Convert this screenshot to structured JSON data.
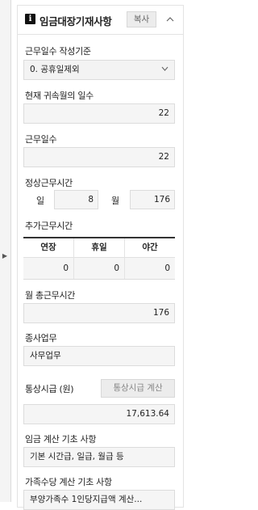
{
  "panel": {
    "title": "임금대장기재사항",
    "copy_label": "복사",
    "collapse_glyph": "^"
  },
  "rail": {
    "arrow_glyph": "▶"
  },
  "work_days_basis": {
    "label": "근무일수 작성기준",
    "value": "0. 공휴일제외"
  },
  "days_in_month": {
    "label": "현재 귀속월의 일수",
    "value": "22"
  },
  "work_days": {
    "label": "근무일수",
    "value": "22"
  },
  "regular_hours": {
    "label": "정상근무시간",
    "day_label": "일",
    "day_value": "8",
    "month_label": "월",
    "month_value": "176"
  },
  "additional_hours": {
    "label": "추가근무시간",
    "columns": [
      "연장",
      "휴일",
      "야간"
    ],
    "values": [
      "0",
      "0",
      "0"
    ]
  },
  "total_monthly_hours": {
    "label": "월 총근무시간",
    "value": "176"
  },
  "job": {
    "label": "종사업무",
    "value": "사무업무"
  },
  "ordinary_wage": {
    "label": "통상시급 (원)",
    "button_label": "통상시급 계산",
    "value": "17,613.64"
  },
  "wage_basis": {
    "label": "임금 계산 기초 사항",
    "value": "기본 시간급, 일급, 월급 등"
  },
  "family_allowance_basis": {
    "label": "가족수당 계산 기초 사항",
    "value": "부양가족수 1인당지급액 계산..."
  }
}
